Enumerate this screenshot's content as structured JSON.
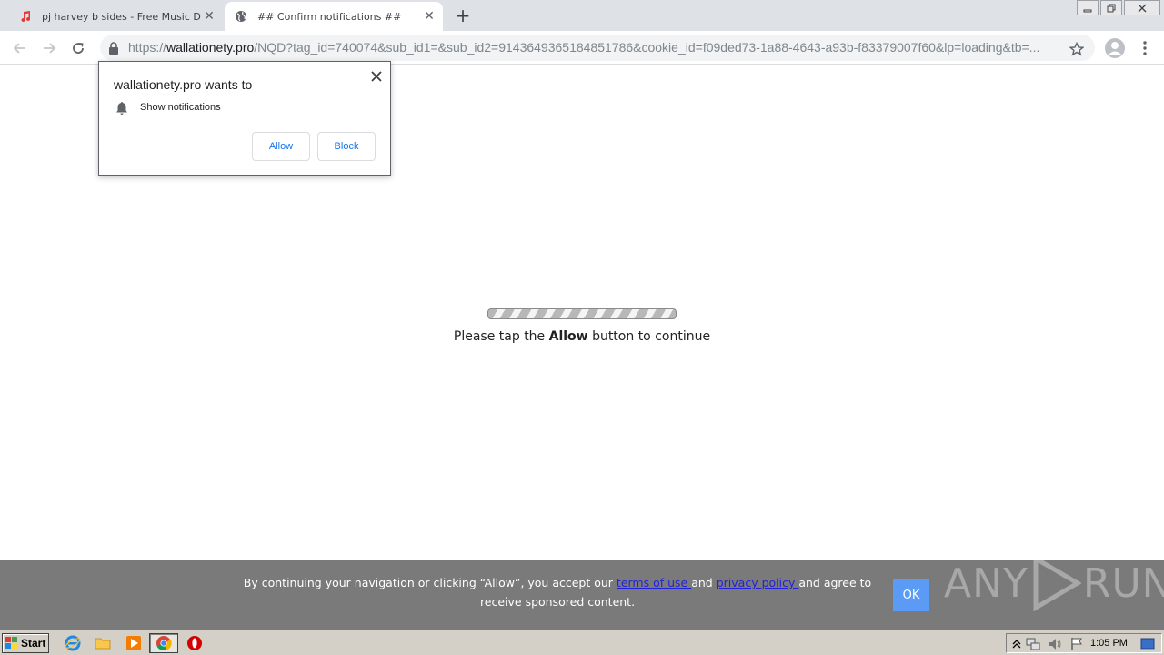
{
  "browser": {
    "tabs": [
      {
        "title": "pj harvey b sides - Free Music Downl",
        "favicon": "music-note-icon",
        "active": false
      },
      {
        "title": "## Confirm notifications ##",
        "favicon": "globe-icon",
        "active": true
      }
    ],
    "address": {
      "scheme": "https://",
      "host": "wallationety.pro",
      "path": "/NQD?tag_id=740074&sub_id1=&sub_id2=9143649365184851786&cookie_id=f09ded73-1a88-4643-a93b-f83379007f60&lp=loading&tb=..."
    }
  },
  "permission_popup": {
    "heading": "wallationety.pro wants to",
    "permission": "Show notifications",
    "allow_label": "Allow",
    "block_label": "Block"
  },
  "page": {
    "progress_fraction": 1.0,
    "continue_prefix": "Please tap the",
    "continue_bold": "Allow",
    "continue_suffix": "button to continue"
  },
  "consent": {
    "text_before": "By continuing your navigation or clicking “Allow”, you accept our ",
    "terms_link": "terms of use ",
    "text_and": "and ",
    "privacy_link": "privacy policy ",
    "text_after": "and agree to receive sponsored content.",
    "ok_label": "OK"
  },
  "watermark": {
    "left": "ANY",
    "right": "RUN"
  },
  "taskbar": {
    "start_label": "Start",
    "clock": "1:05 PM"
  },
  "colors": {
    "accent": "#1a73e8",
    "consent_bg": "#7a7a7a",
    "ok_button": "#5b9bf5",
    "link": "#2222dd"
  }
}
